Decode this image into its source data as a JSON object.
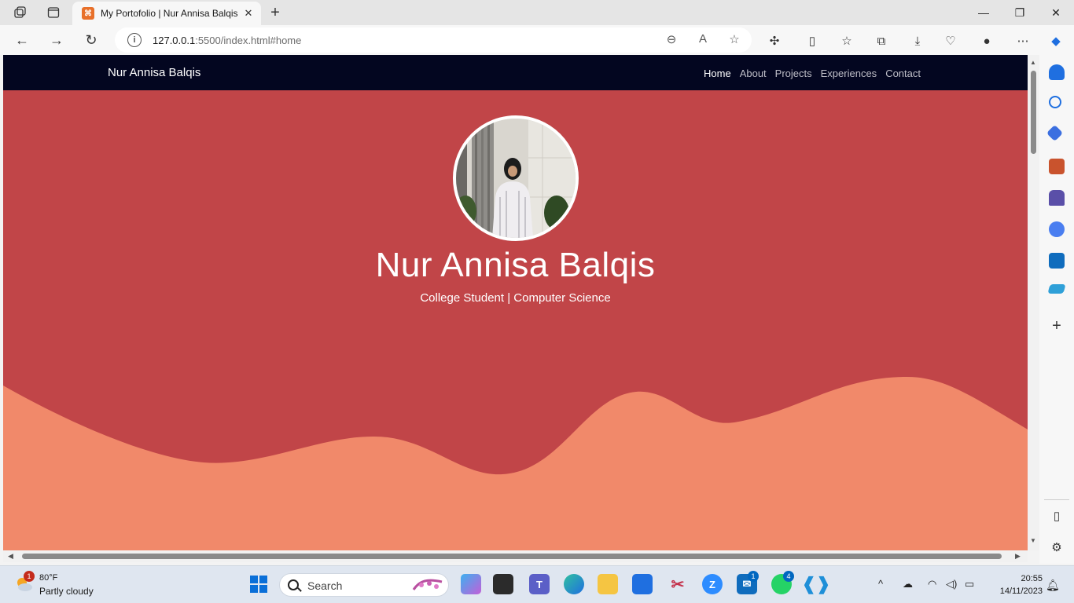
{
  "browser": {
    "tab": {
      "favicon_label": "⌘",
      "title": "My Portofolio | Nur Annisa Balqis",
      "close": "✕"
    },
    "new_tab": "+",
    "window_controls": {
      "minimize": "—",
      "maximize": "❐",
      "close": "✕"
    },
    "url": {
      "host": "127.0.0.1",
      "rest": ":5500/index.html#home"
    },
    "nav": {
      "back": "←",
      "forward": "→",
      "reload": "↻"
    }
  },
  "site": {
    "brand": "Nur Annisa Balqis",
    "nav_items": [
      {
        "label": "Home",
        "active": true
      },
      {
        "label": "About",
        "active": false
      },
      {
        "label": "Projects",
        "active": false
      },
      {
        "label": "Experiences",
        "active": false
      },
      {
        "label": "Contact",
        "active": false
      }
    ],
    "hero": {
      "name": "Nur Annisa Balqis",
      "subtitle": "College Student | Computer Science"
    },
    "colors": {
      "nav_bg": "#030620",
      "hero_red": "#c14548",
      "wave_salmon": "#f1896a"
    }
  },
  "taskbar": {
    "weather": {
      "temp": "80°F",
      "desc": "Partly cloudy",
      "badge": "1"
    },
    "search_label": "Search",
    "app_badges": {
      "mail": "1",
      "whatsapp": "4"
    },
    "clock": {
      "time": "20:55",
      "date": "14/11/2023"
    }
  }
}
